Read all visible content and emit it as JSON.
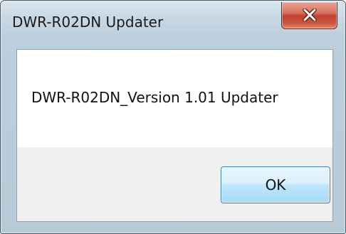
{
  "window": {
    "title": "DWR-R02DN Updater",
    "close_icon": "close-icon"
  },
  "dialog": {
    "message": "DWR-R02DN_Version 1.01 Updater",
    "ok_label": "OK"
  },
  "colors": {
    "frame": "#c9d8e4",
    "close_button": "#c4402b",
    "ok_button": "#bee6fd",
    "footer": "#f0f0f0"
  }
}
